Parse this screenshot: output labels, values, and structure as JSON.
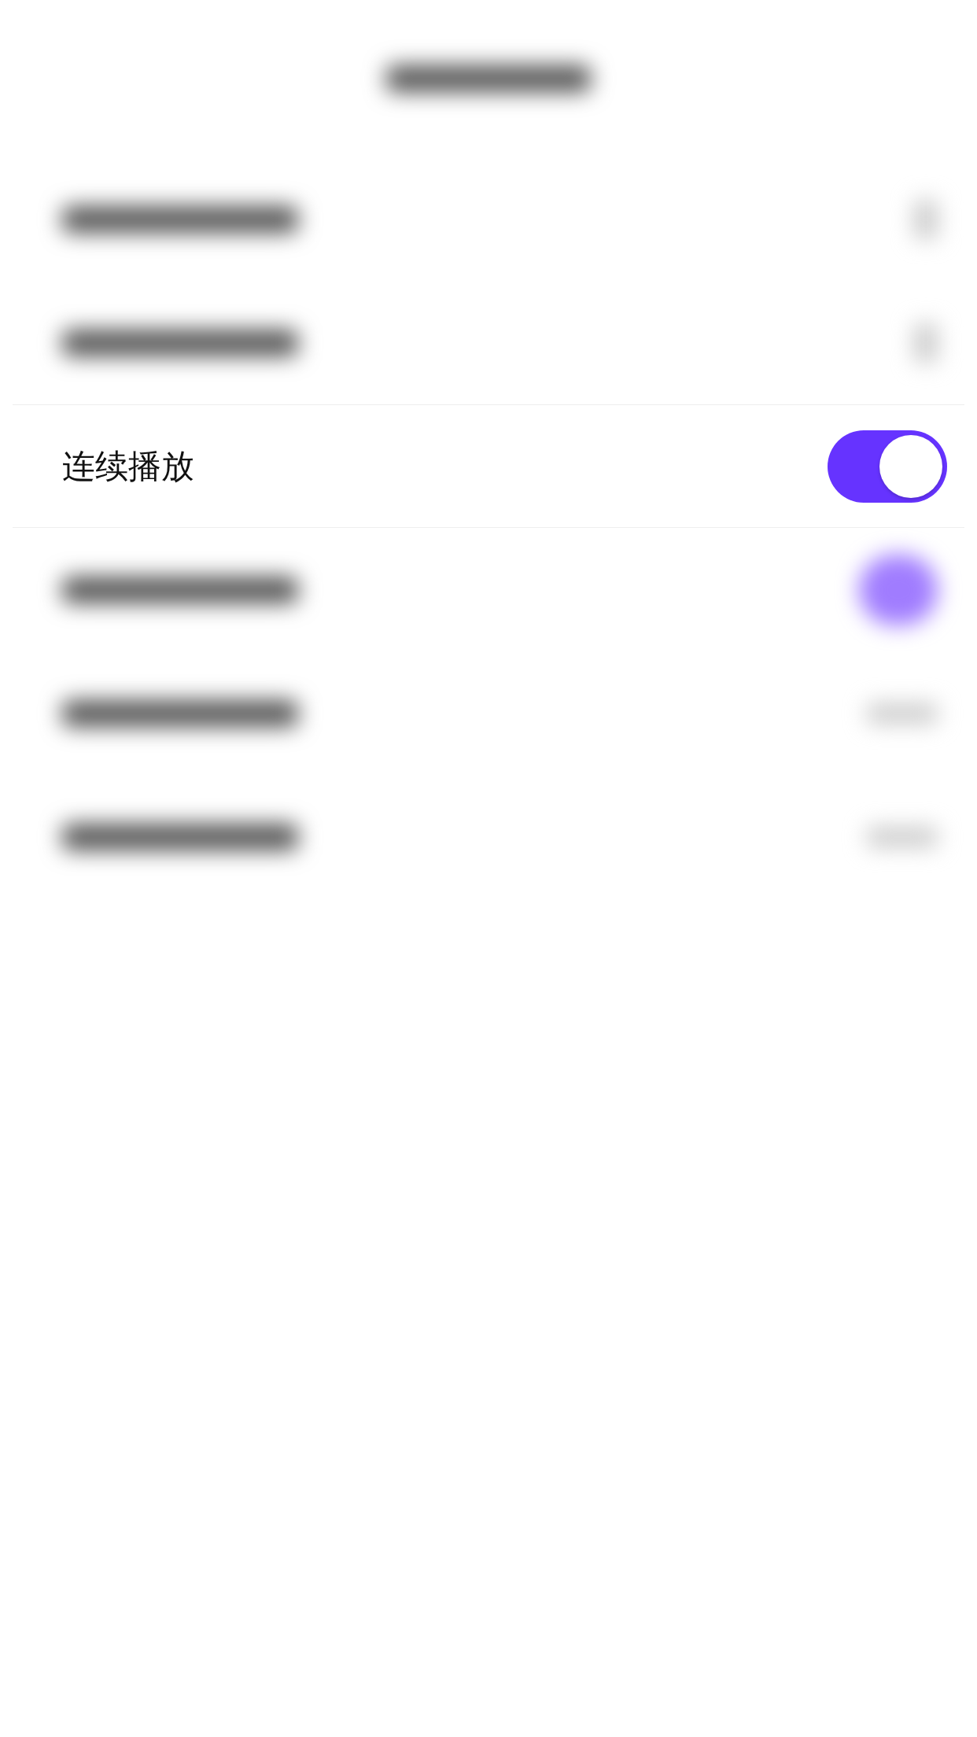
{
  "blurred_rows_above": [
    {
      "kind": "chevron"
    },
    {
      "kind": "chevron"
    }
  ],
  "focused_row": {
    "label": "连续播放",
    "on": true
  },
  "blurred_rows_below": [
    {
      "kind": "toggle"
    },
    {
      "kind": "value"
    },
    {
      "kind": "value"
    }
  ]
}
